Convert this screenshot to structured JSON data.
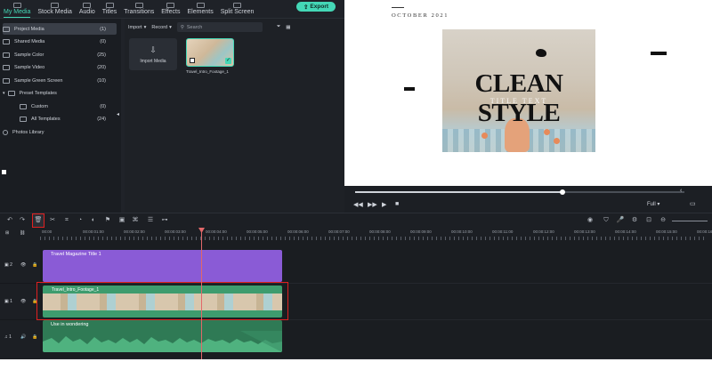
{
  "tabs": [
    {
      "label": "My Media",
      "active": true
    },
    {
      "label": "Stock Media"
    },
    {
      "label": "Audio"
    },
    {
      "label": "Titles"
    },
    {
      "label": "Transitions"
    },
    {
      "label": "Effects"
    },
    {
      "label": "Elements"
    },
    {
      "label": "Split Screen"
    }
  ],
  "export_label": "Export",
  "sidebar": {
    "items": [
      {
        "label": "Project Media",
        "count": "(1)"
      },
      {
        "label": "Shared Media",
        "count": "(0)"
      },
      {
        "label": "Sample Color",
        "count": "(25)"
      },
      {
        "label": "Sample Video",
        "count": "(20)"
      },
      {
        "label": "Sample Green Screen",
        "count": "(10)"
      },
      {
        "label": "Preset Templates",
        "count": ""
      },
      {
        "label": "Custom",
        "count": "(0)"
      },
      {
        "label": "All Templates",
        "count": "(24)"
      },
      {
        "label": "Photos Library",
        "count": ""
      }
    ]
  },
  "media_toolbar": {
    "import_label": "Import",
    "record_label": "Record",
    "search_placeholder": "Search"
  },
  "import_tile_label": "Import Media",
  "clip_name": "Travel_Intro_Footage_1",
  "preview": {
    "date": "OCTOBER 2021",
    "title": "CLEAN STYLE",
    "subtitle": "TITLE TEXT"
  },
  "player": {
    "quality": "Full",
    "progress": 0.63
  },
  "ruler_ticks": [
    "00:00",
    "00:00:01:00",
    "00:00:02:00",
    "00:00:03:00",
    "00:00:04:00",
    "00:00:05:00",
    "00:00:06:00",
    "00:00:07:00",
    "00:00:08:00",
    "00:00:09:00",
    "00:00:10:00",
    "00:00:11:00",
    "00:00:12:00",
    "00:00:13:00",
    "00:00:14:00",
    "00:00:15:00",
    "00:00:16:00"
  ],
  "tracks": [
    {
      "label": "2",
      "clip": "Travel Magazine Title 1"
    },
    {
      "label": "1",
      "clip": "Travel_Intro_Footage_1"
    },
    {
      "label": "1",
      "clip": "Use in wondering"
    }
  ],
  "accent": "#44d7b6"
}
